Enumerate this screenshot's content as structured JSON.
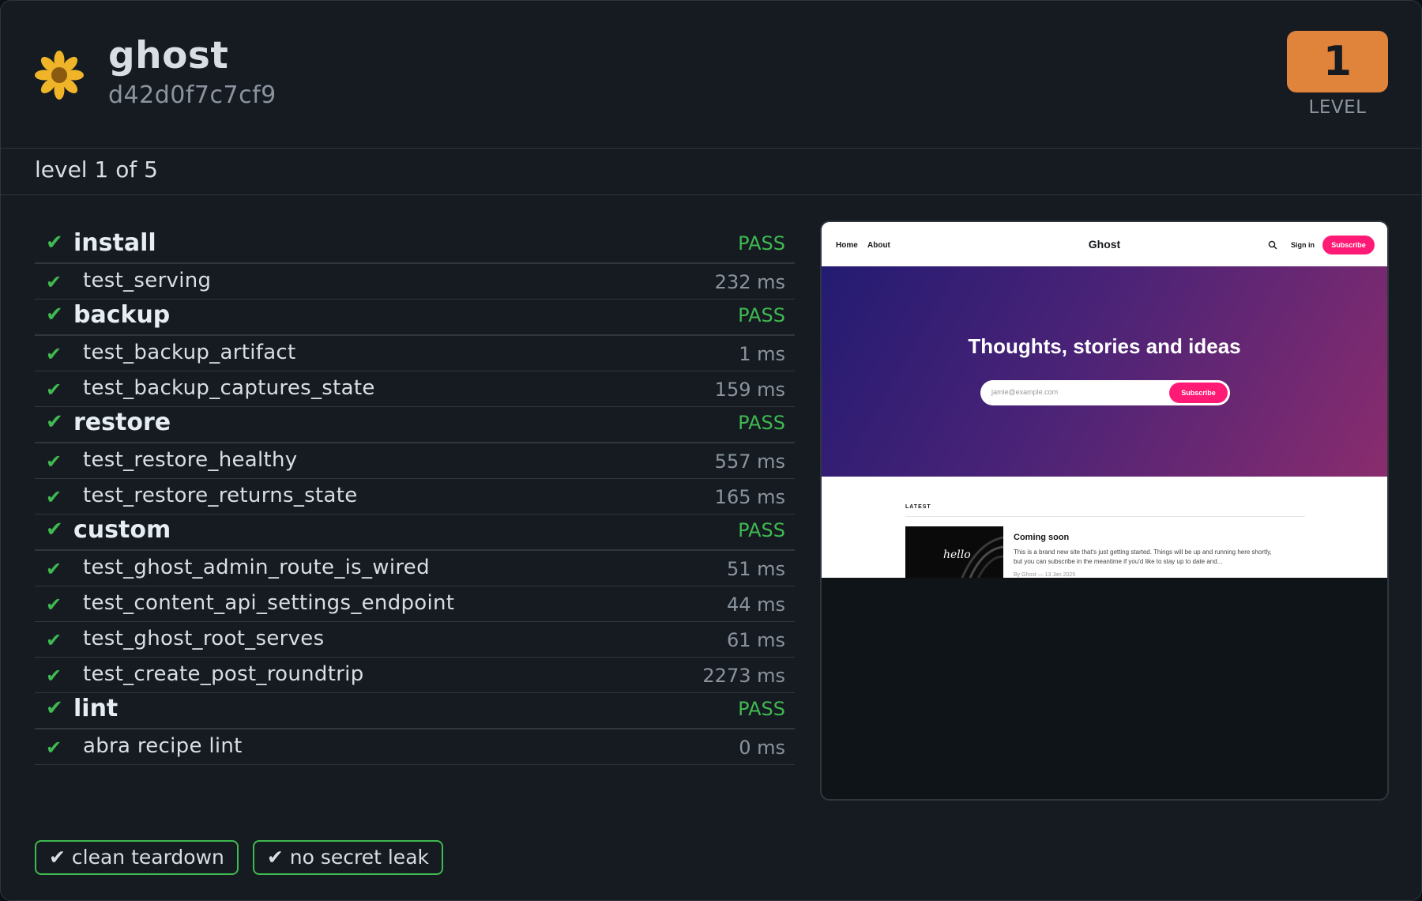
{
  "header": {
    "logo_icon": "flower-icon",
    "app_name": "ghost",
    "app_hash": "d42d0f7c7cf9",
    "level_value": "1",
    "level_label": "LEVEL",
    "level_color": "#e0833b"
  },
  "subheader": {
    "level_progress": "level 1 of 5"
  },
  "check_symbol": "✔",
  "groups": [
    {
      "name": "install",
      "status": "PASS",
      "tests": [
        {
          "name": "test_serving",
          "time": "232 ms"
        }
      ]
    },
    {
      "name": "backup",
      "status": "PASS",
      "tests": [
        {
          "name": "test_backup_artifact",
          "time": "1 ms"
        },
        {
          "name": "test_backup_captures_state",
          "time": "159 ms"
        }
      ]
    },
    {
      "name": "restore",
      "status": "PASS",
      "tests": [
        {
          "name": "test_restore_healthy",
          "time": "557 ms"
        },
        {
          "name": "test_restore_returns_state",
          "time": "165 ms"
        }
      ]
    },
    {
      "name": "custom",
      "status": "PASS",
      "tests": [
        {
          "name": "test_ghost_admin_route_is_wired",
          "time": "51 ms"
        },
        {
          "name": "test_content_api_settings_endpoint",
          "time": "44 ms"
        },
        {
          "name": "test_ghost_root_serves",
          "time": "61 ms"
        },
        {
          "name": "test_create_post_roundtrip",
          "time": "2273 ms"
        }
      ]
    },
    {
      "name": "lint",
      "status": "PASS",
      "tests": [
        {
          "name": "abra recipe lint",
          "time": "0 ms"
        }
      ]
    }
  ],
  "footer_badges": [
    {
      "label": "✔ clean teardown"
    },
    {
      "label": "✔ no secret leak"
    }
  ],
  "preview": {
    "nav_links": [
      "Home",
      "About"
    ],
    "brand": "Ghost",
    "search_icon": "search-icon",
    "signin": "Sign in",
    "subscribe": "Subscribe",
    "hero_title": "Thoughts, stories and ideas",
    "email_placeholder": "jamie@example.com",
    "hero_subscribe": "Subscribe",
    "latest_label": "LATEST",
    "post_image_text": "hello",
    "post_title": "Coming soon",
    "post_excerpt": "This is a brand new site that's just getting started. Things will be up and running here shortly, but you can subscribe in the meantime if you'd like to stay up to date and...",
    "post_meta": "By Ghost — 13 Jan 2025",
    "accent_color": "#ff1a75"
  },
  "colors": {
    "pass": "#3fb950",
    "background": "#161b22",
    "border": "#30363d"
  }
}
